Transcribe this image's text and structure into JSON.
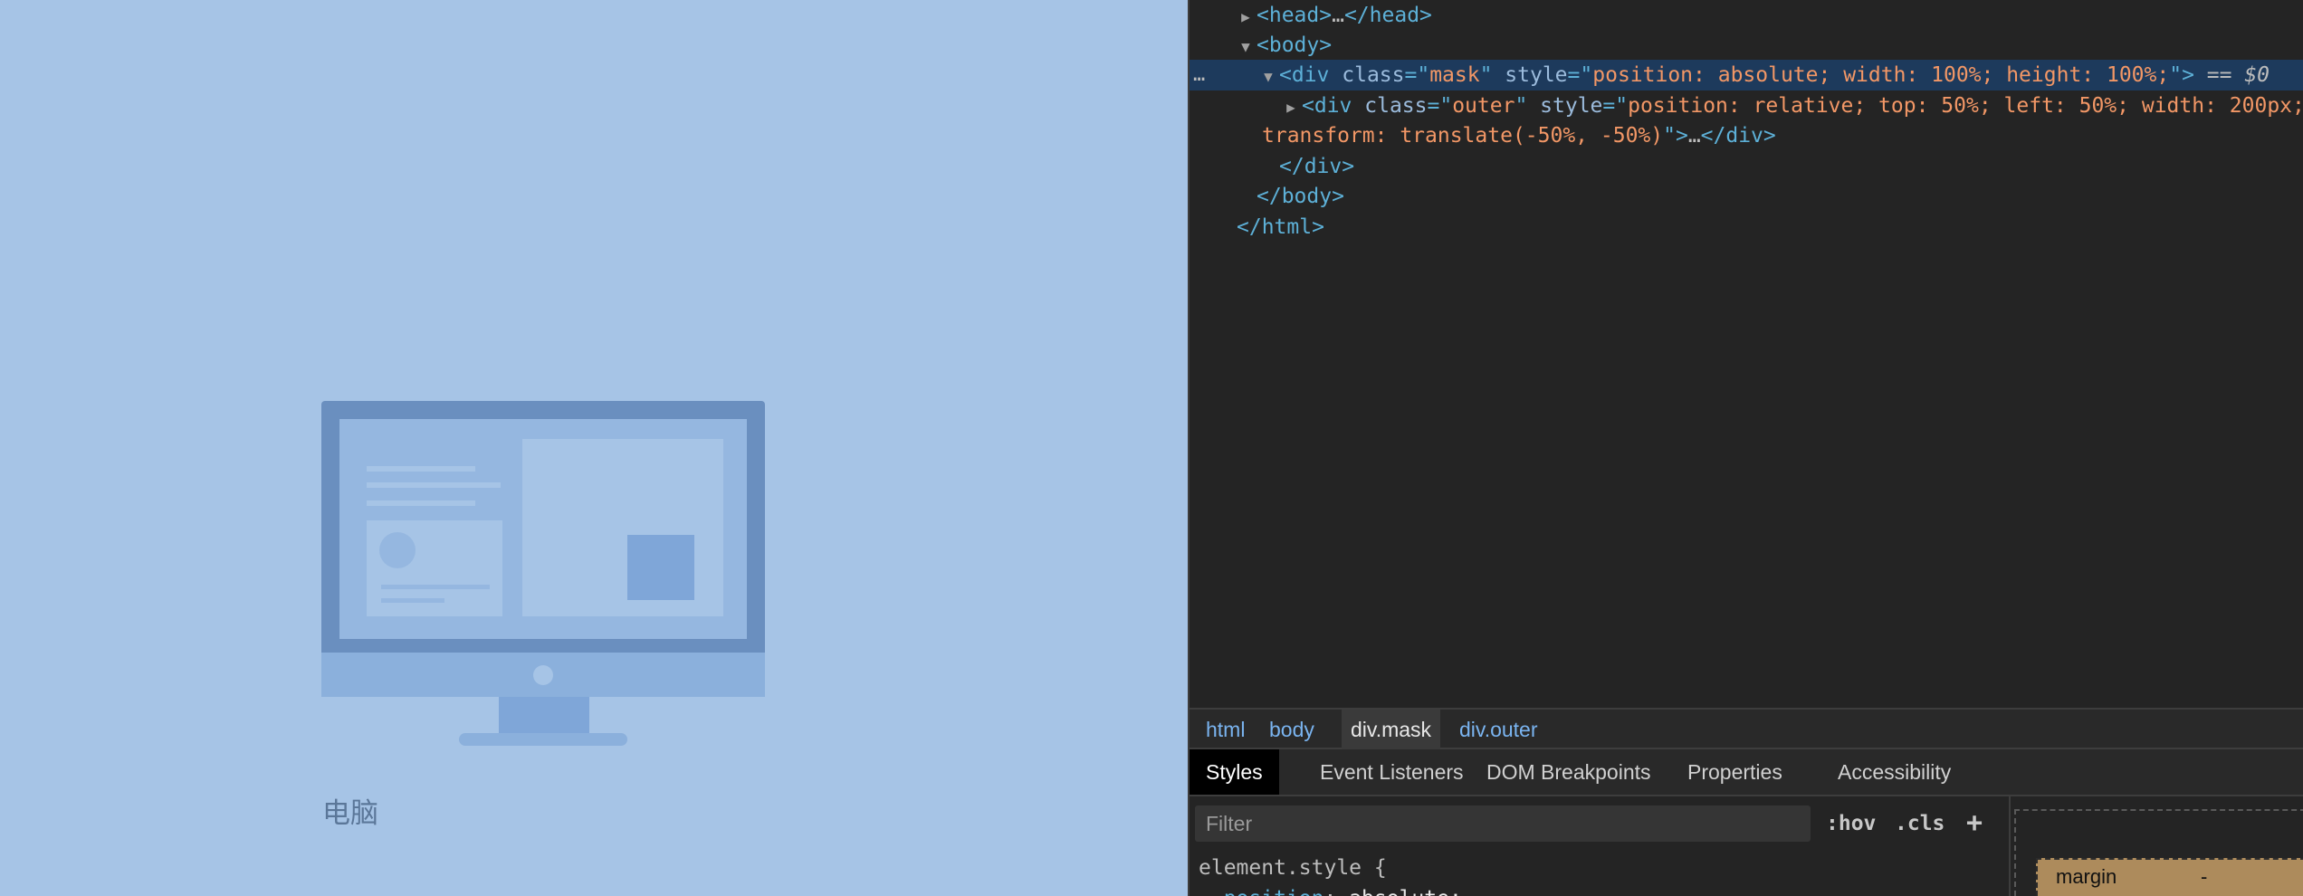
{
  "page": {
    "label": "电脑",
    "icon": "desktop-computer-icon",
    "colors": {
      "background": "#a6c4e6",
      "monitor_frame": "#6a8fbf",
      "monitor_base": "#8bb0dc"
    }
  },
  "devtools": {
    "dom_lines": [
      {
        "indent": 1,
        "triangle": "right",
        "parts": [
          [
            "tag",
            "<head>"
          ],
          [
            "dim",
            "…"
          ],
          [
            "tag",
            "</head>"
          ]
        ]
      },
      {
        "indent": 1,
        "triangle": "down",
        "parts": [
          [
            "tag",
            "<body>"
          ]
        ]
      },
      {
        "indent": 2,
        "triangle": "down",
        "selected": true,
        "parts": [
          [
            "tag",
            "<div "
          ],
          [
            "attr",
            "class"
          ],
          [
            "punc",
            "=\""
          ],
          [
            "val",
            "mask"
          ],
          [
            "punc",
            "\" "
          ],
          [
            "attr",
            "style"
          ],
          [
            "punc",
            "=\""
          ],
          [
            "val",
            "position: absolute; width: 100%; height: 100%;"
          ],
          [
            "punc",
            "\">"
          ],
          [
            "eq",
            " == $0"
          ]
        ]
      },
      {
        "indent": 3,
        "triangle": "right",
        "parts": [
          [
            "tag",
            "<div "
          ],
          [
            "attr",
            "class"
          ],
          [
            "punc",
            "=\""
          ],
          [
            "val",
            "outer"
          ],
          [
            "punc",
            "\" "
          ],
          [
            "attr",
            "style"
          ],
          [
            "punc",
            "=\""
          ],
          [
            "val",
            "position: relative; top: 50%; left: 50%; width: 200px;"
          ]
        ]
      },
      {
        "indent": 3,
        "triangle": "",
        "parts": [
          [
            "val",
            "transform: translate(-50%, -50%)"
          ],
          [
            "punc",
            "\">"
          ],
          [
            "dim",
            "…"
          ],
          [
            "tag",
            "</div>"
          ]
        ]
      },
      {
        "indent": 2,
        "triangle": "",
        "parts": [
          [
            "tag",
            "</div>"
          ]
        ]
      },
      {
        "indent": 1,
        "triangle": "",
        "parts": [
          [
            "tag",
            "</body>"
          ]
        ]
      },
      {
        "indent": 0,
        "triangle": "",
        "parts": [
          [
            "tag",
            "</html>"
          ]
        ]
      }
    ],
    "selected_dots": "…",
    "breadcrumbs": [
      {
        "label": "html",
        "active": false
      },
      {
        "label": "body",
        "active": false
      },
      {
        "label": "div.mask",
        "active": true
      },
      {
        "label": "div.outer",
        "active": false
      }
    ],
    "tabs": [
      {
        "label": "Styles",
        "active": true
      },
      {
        "label": "Event Listeners",
        "active": false
      },
      {
        "label": "DOM Breakpoints",
        "active": false
      },
      {
        "label": "Properties",
        "active": false
      },
      {
        "label": "Accessibility",
        "active": false
      }
    ],
    "styles": {
      "filter_placeholder": "Filter",
      "hov": ":hov",
      "cls": ".cls",
      "plus": "+",
      "rule_selector": "element.style {",
      "rule_prop": "position",
      "rule_value": "absolute;"
    },
    "box_model": {
      "margin_label": "margin",
      "margin_value": "-"
    }
  }
}
